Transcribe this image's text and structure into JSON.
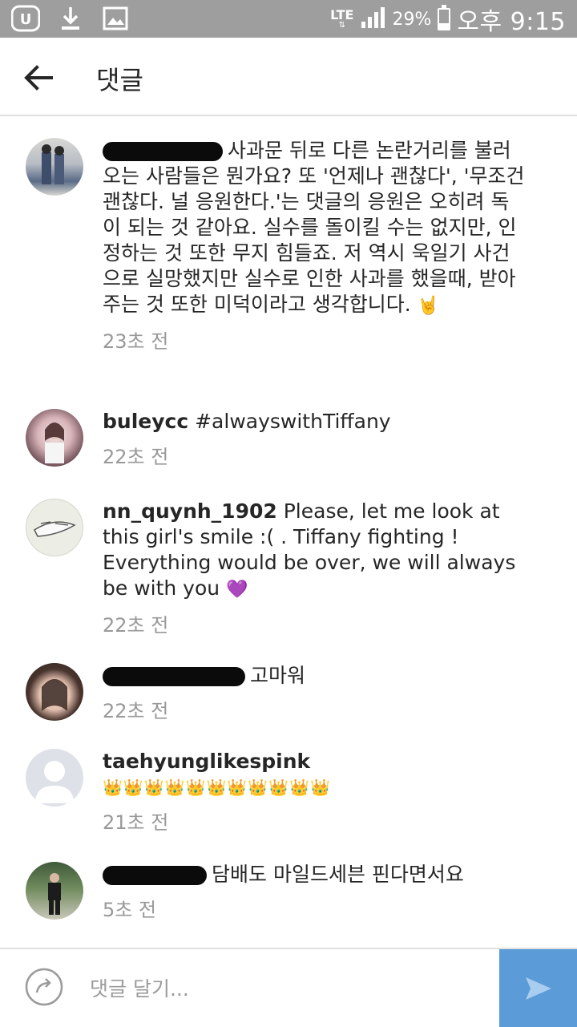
{
  "status_bar": {
    "network": "LTE",
    "battery_percent": "29%",
    "battery_level": 0.29,
    "ampm": "오후",
    "time": "9:15",
    "icons": [
      "app-badge-icon",
      "download-icon",
      "image-icon",
      "signal-icon",
      "battery-icon"
    ]
  },
  "header": {
    "title": "댓글",
    "back_icon": "arrow-left-icon"
  },
  "comments": [
    {
      "username": "",
      "text": "사과문 뒤로 다른 논란거리를 불러오는 사람들은 뭔가요? 또 '언제나 괜찮다', '무조건 괜찮다. 널 응원한다.'는 댓글의 응원은 오히려 독이 되는 것 같아요.  실수를 돌이킬 수는 없지만, 인정하는 것 또한 무지 힘들죠.  저 역시 욱일기 사건으로 실망했지만 실수로 인한 사과를 했을때, 받아주는 것 또한 미덕이라고 생각합니다.",
      "emoji": "🤘",
      "time": "23초 전"
    },
    {
      "username": "buleycc",
      "text": "#alwayswithTiffany",
      "emoji": "",
      "time": "22초 전"
    },
    {
      "username": "nn_quynh_1902",
      "text": "Please, let me look at this girl's smile :( . Tiffany fighting ! Everything would be over, we will always be with you",
      "emoji": "💜",
      "time": "22초 전"
    },
    {
      "username": "",
      "text": "고마워",
      "emoji": "",
      "time": "22초 전"
    },
    {
      "username": "taehyunglikespink",
      "text": "",
      "emoji": "👑👑👑👑👑👑👑👑👑👑👑",
      "time": "21초 전"
    },
    {
      "username": "",
      "text": "담배도 마일드세븐 핀다면서요",
      "emoji": "",
      "time": "5초 전"
    }
  ],
  "composer": {
    "placeholder": "댓글 달기...",
    "left_icon": "share-arrow-icon",
    "send_icon": "send-icon",
    "send_color": "#5a9bd8"
  }
}
